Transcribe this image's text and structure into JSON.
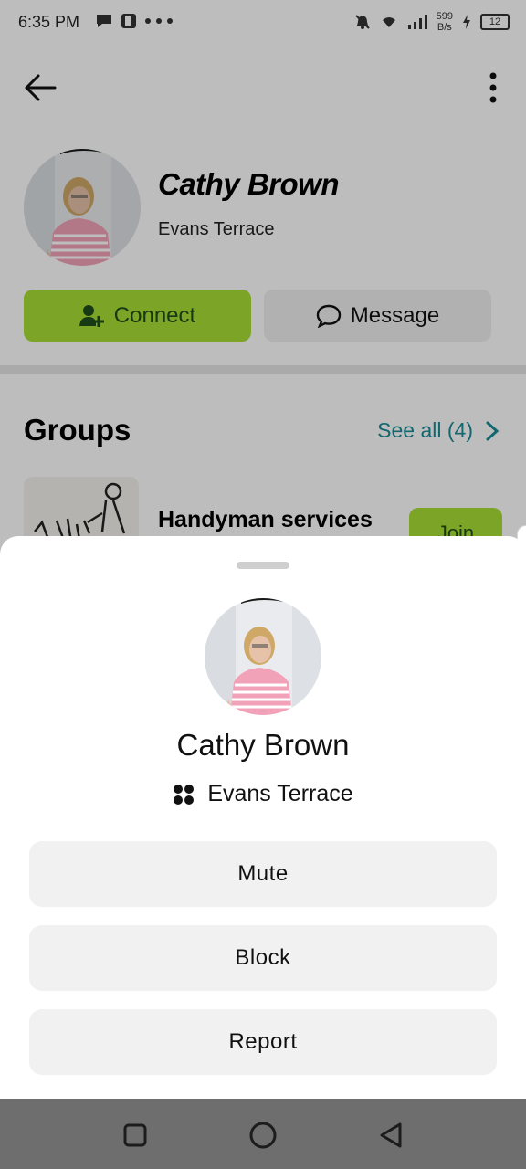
{
  "status_bar": {
    "time": "6:35 PM",
    "net_speed_value": "599",
    "net_speed_unit": "B/s",
    "battery": "12"
  },
  "profile": {
    "name": "Cathy Brown",
    "location": "Evans Terrace",
    "connect_label": "Connect",
    "message_label": "Message"
  },
  "groups": {
    "title": "Groups",
    "see_all_label": "See all (4)",
    "items": [
      {
        "name": "Handyman services",
        "join_label": "Join"
      }
    ]
  },
  "sheet": {
    "name": "Cathy Brown",
    "location": "Evans Terrace",
    "actions": [
      {
        "label": "Mute"
      },
      {
        "label": "Block"
      },
      {
        "label": "Report"
      }
    ]
  },
  "colors": {
    "accent_green": "#a8dd35",
    "link_teal": "#1a8c95",
    "button_grey": "#f1f1f1"
  },
  "icons": [
    "back-arrow-icon",
    "more-vert-icon",
    "add-person-icon",
    "chat-bubble-icon",
    "chevron-right-icon",
    "community-dots-icon",
    "square-nav-icon",
    "circle-nav-icon",
    "triangle-back-icon"
  ]
}
